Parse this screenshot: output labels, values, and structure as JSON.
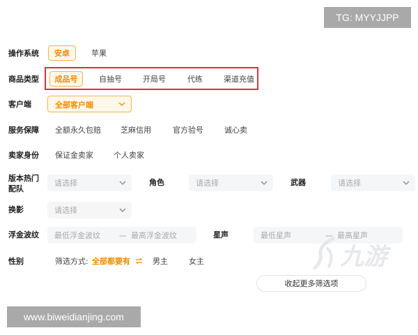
{
  "watermark_top": "TG: MYYJJPP",
  "watermark_bottom": "www.biweidianjing.com",
  "brand_watermark": "九游",
  "os": {
    "label": "操作系统",
    "options": [
      "安卓",
      "苹果"
    ],
    "selected": "安卓"
  },
  "product_type": {
    "label": "商品类型",
    "options": [
      "成品号",
      "自抽号",
      "开局号",
      "代练",
      "渠道充值"
    ],
    "selected": "成品号"
  },
  "client": {
    "label": "客户端",
    "value": "全部客户端"
  },
  "service": {
    "label": "服务保障",
    "options": [
      "全额永久包赔",
      "芝麻信用",
      "官方验号",
      "诚心卖"
    ]
  },
  "seller": {
    "label": "卖家身份",
    "options": [
      "保证金卖家",
      "个人卖家"
    ]
  },
  "team": {
    "label": "版本热门配队",
    "placeholder": "请选择"
  },
  "role": {
    "label": "角色",
    "placeholder": "请选择"
  },
  "weapon": {
    "label": "武器",
    "placeholder": "请选择"
  },
  "skin": {
    "label": "换影",
    "placeholder": "请选择"
  },
  "float_gold": {
    "label": "浮金波纹",
    "min_placeholder": "最低浮金波纹",
    "max_placeholder": "最高浮金波纹",
    "separator": "—"
  },
  "star_voice": {
    "label": "星声",
    "min_placeholder": "最低星声",
    "max_placeholder": "最高星声",
    "separator": "—"
  },
  "gender": {
    "label": "性别",
    "filter_label": "筛选方式:",
    "filter_value": "全部都要有",
    "options": [
      "男主",
      "女主"
    ]
  },
  "collapse_button": "收起更多筛选项",
  "colors": {
    "accent": "#f08c00",
    "highlight_border": "#d6313a",
    "watermark_bg": "#a9a9a9"
  }
}
